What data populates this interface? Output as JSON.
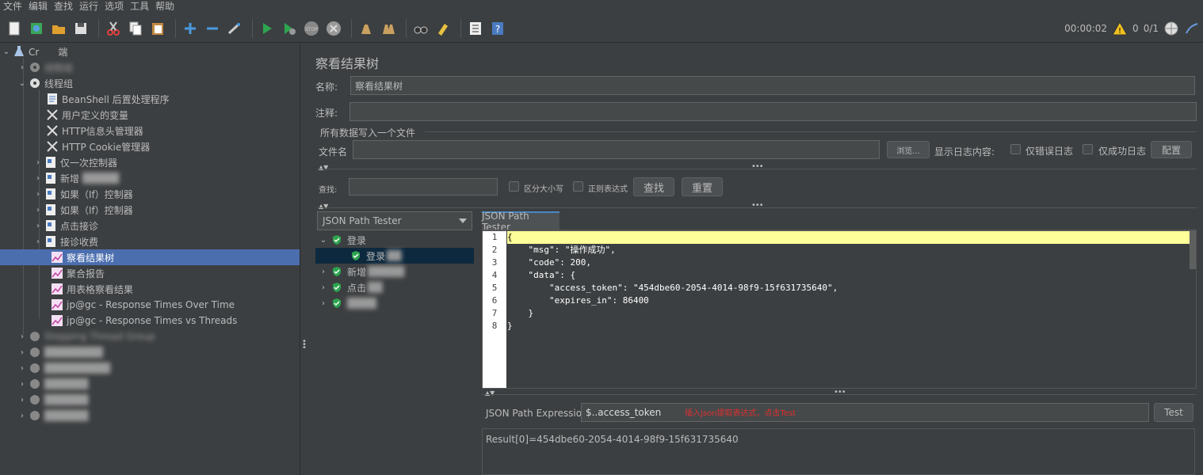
{
  "menu": [
    "文件",
    "编辑",
    "查找",
    "运行",
    "选项",
    "工具",
    "帮助"
  ],
  "toolbar": {
    "timer": "00:00:02",
    "warn_count": "0",
    "threads": "0/1"
  },
  "tree": {
    "root_label": "Cr  端",
    "items": [
      {
        "label": "线程组",
        "blurred": true
      },
      {
        "label": "线程组"
      },
      {
        "label": "BeanShell 后置处理程序"
      },
      {
        "label": "用户定义的变量"
      },
      {
        "label": "HTTP信息头管理器"
      },
      {
        "label": "HTTP Cookie管理器"
      },
      {
        "label": "仅一次控制器"
      },
      {
        "label": "新增"
      },
      {
        "label": "如果（If）控制器"
      },
      {
        "label": "如果（If）控制器"
      },
      {
        "label": "点击接诊"
      },
      {
        "label": "接诊收费"
      },
      {
        "label": "察看结果树"
      },
      {
        "label": "聚合报告"
      },
      {
        "label": "用表格察看结果"
      },
      {
        "label": "jp@gc - Response Times Over Time"
      },
      {
        "label": "jp@gc - Response Times vs Threads"
      },
      {
        "label": "Stepping Thread Group"
      }
    ]
  },
  "panel": {
    "title": "察看结果树",
    "name_label": "名称:",
    "name_value": "察看结果树",
    "comment_label": "注释:",
    "comment_value": "",
    "file_section": "所有数据写入一个文件",
    "filename_label": "文件名",
    "filename_value": "",
    "browse_button": "浏览...",
    "log_label": "显示日志内容:",
    "errors_only": "仅错误日志",
    "success_only": "仅成功日志",
    "configure_button": "配置",
    "search_label": "查找:",
    "search_value": "",
    "case_sensitive": "区分大小写",
    "regex": "正则表达式",
    "find_button": "查找",
    "reset_button": "重置"
  },
  "results": {
    "renderer": "JSON Path Tester",
    "samples": [
      {
        "label": "登录"
      },
      {
        "label": "登录"
      },
      {
        "label": "新增"
      },
      {
        "label": "点击"
      },
      {
        "label": ""
      }
    ]
  },
  "tester": {
    "tab_label": "JSON Path Tester",
    "line_numbers": [
      "1",
      "2",
      "3",
      "4",
      "5",
      "6",
      "7",
      "8"
    ],
    "code_lines": [
      "{",
      "    \"msg\": \"操作成功\",",
      "    \"code\": 200,",
      "    \"data\": {",
      "        \"access_token\": \"454dbe60-2054-4014-98f9-15f631735640\",",
      "        \"expires_in\": 86400",
      "    }",
      "}"
    ],
    "expr_label": "JSON Path Expression",
    "expr_value": "$..access_token",
    "annotation": "插入json提取表达式，点击Test",
    "test_button": "Test",
    "result_text": "Result[0]=454dbe60-2054-4014-98f9-15f631735640"
  },
  "colors": {
    "background": "#3c3f41",
    "selection": "#4b6eaf",
    "highlight_line": "#ffff99",
    "annotation": "#e03030",
    "success_icon": "#2ea44f"
  }
}
